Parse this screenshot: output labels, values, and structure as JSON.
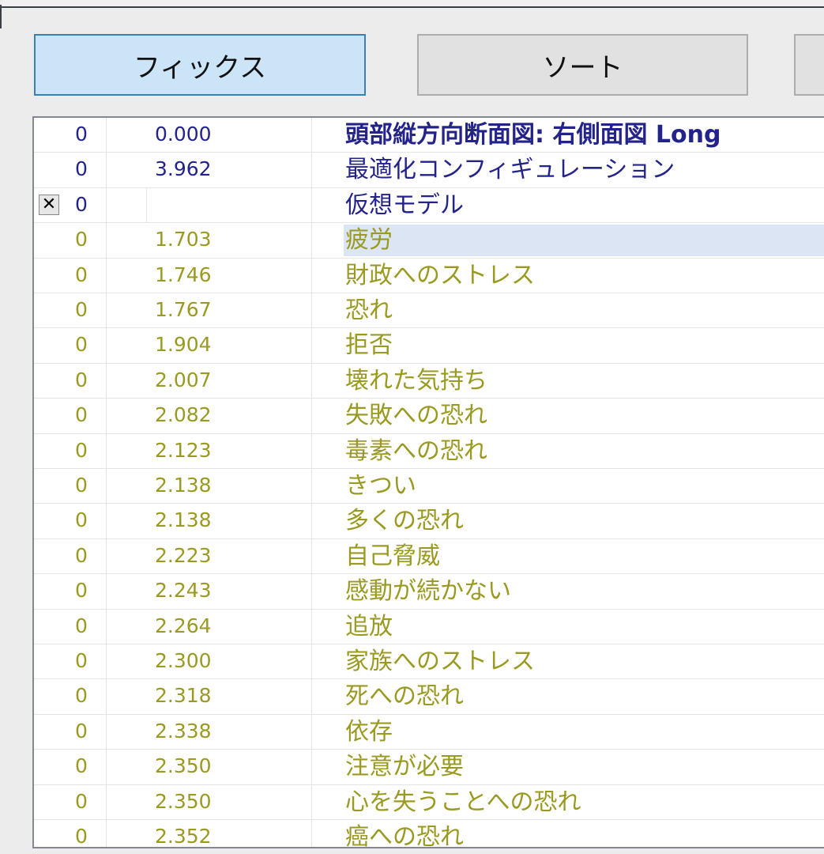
{
  "toolbar": {
    "fix_label": "フィックス",
    "sort_label": "ソート"
  },
  "colors": {
    "header_text": "#23238a",
    "item_text": "#9a9a22",
    "selected_row": "#dbe5f3",
    "active_button": "#cce4f7"
  },
  "rows": [
    {
      "a": "0",
      "b": "0.000",
      "text": "頭部縦方向断面図: 右側面図 Long",
      "style": "blue bold"
    },
    {
      "a": "0",
      "b": "3.962",
      "text": "最適化コンフィギュレーション",
      "style": "blue"
    },
    {
      "a": "0",
      "b": "",
      "text": "仮想モデル",
      "style": "blue",
      "checkbox": "✕"
    },
    {
      "a": "0",
      "b": "1.703",
      "text": "疲労",
      "style": "olive",
      "selected": true
    },
    {
      "a": "0",
      "b": "1.746",
      "text": "財政へのストレス",
      "style": "olive"
    },
    {
      "a": "0",
      "b": "1.767",
      "text": "恐れ",
      "style": "olive"
    },
    {
      "a": "0",
      "b": "1.904",
      "text": "拒否",
      "style": "olive"
    },
    {
      "a": "0",
      "b": "2.007",
      "text": "壊れた気持ち",
      "style": "olive"
    },
    {
      "a": "0",
      "b": "2.082",
      "text": "失敗への恐れ",
      "style": "olive"
    },
    {
      "a": "0",
      "b": "2.123",
      "text": "毒素への恐れ",
      "style": "olive"
    },
    {
      "a": "0",
      "b": "2.138",
      "text": "きつい",
      "style": "olive"
    },
    {
      "a": "0",
      "b": "2.138",
      "text": "多くの恐れ",
      "style": "olive"
    },
    {
      "a": "0",
      "b": "2.223",
      "text": "自己脅威",
      "style": "olive"
    },
    {
      "a": "0",
      "b": "2.243",
      "text": "感動が続かない",
      "style": "olive"
    },
    {
      "a": "0",
      "b": "2.264",
      "text": "追放",
      "style": "olive"
    },
    {
      "a": "0",
      "b": "2.300",
      "text": "家族へのストレス",
      "style": "olive"
    },
    {
      "a": "0",
      "b": "2.318",
      "text": "死への恐れ",
      "style": "olive"
    },
    {
      "a": "0",
      "b": "2.338",
      "text": "依存",
      "style": "olive"
    },
    {
      "a": "0",
      "b": "2.350",
      "text": "注意が必要",
      "style": "olive"
    },
    {
      "a": "0",
      "b": "2.350",
      "text": "心を失うことへの恐れ",
      "style": "olive"
    },
    {
      "a": "0",
      "b": "2.352",
      "text": "癌への恐れ",
      "style": "olive"
    }
  ]
}
